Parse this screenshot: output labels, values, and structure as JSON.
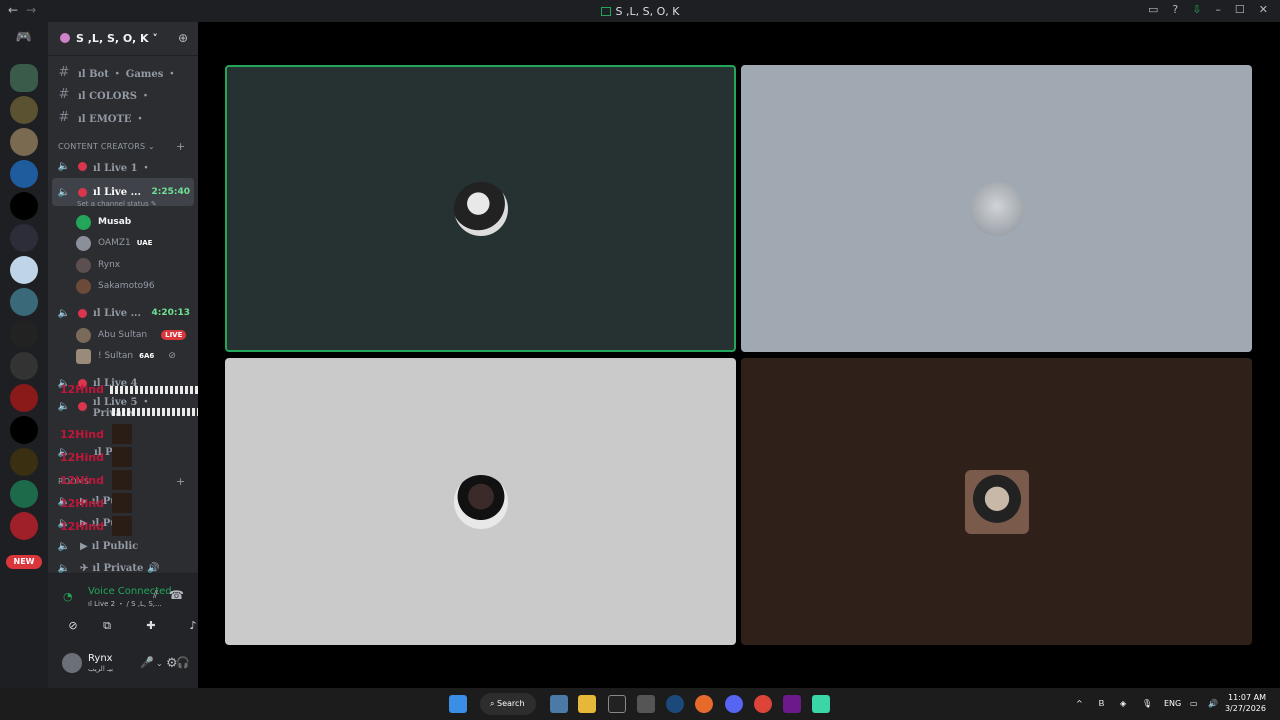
{
  "window": {
    "title": "S ,L, S, O, K"
  },
  "server": {
    "name": "S ,L, S, O, K"
  },
  "channels": {
    "text": [
      {
        "label": "ıl Bot ・ Games ・"
      },
      {
        "label": "ıl COLORS ・"
      },
      {
        "label": "ıl EMOTE ・"
      }
    ],
    "category": "CONTENT CREATORS",
    "voice1": {
      "label": "ıl Live 1 ・"
    },
    "voice2": {
      "label": "ıl Live ...",
      "time": "2:25:40",
      "status": "Set a channel status"
    },
    "voice2_users": [
      {
        "name": "Musab"
      },
      {
        "name": "OAMZ1",
        "tag": "UAE"
      },
      {
        "name": "Rynx"
      },
      {
        "name": "Sakamoto96"
      }
    ],
    "voice3": {
      "label": "ıl Live ...",
      "time": "4:20:13"
    },
    "voice3_users": [
      {
        "name": "Abu Sultan",
        "badge": "LIVE"
      },
      {
        "name": "! Sultan",
        "tag": "6A6"
      }
    ],
    "voice4": {
      "label": "ıl Live 4"
    },
    "voice5": {
      "label": "ıl Live 5 ・ Private"
    },
    "pull": {
      "label": "ıl Pull"
    },
    "category2": "ROOMS",
    "pu1": {
      "label": "ıl Pu"
    },
    "pu2": {
      "label": "ıl Pu"
    },
    "public": {
      "label": "ıl Public"
    },
    "private": {
      "label": "ıl Private"
    }
  },
  "overlay": {
    "text": "12Hind"
  },
  "voice_panel": {
    "title": "Voice Connected",
    "subtitle": "ıl Live 2 ・ / S ,L, S,..."
  },
  "user_panel": {
    "name": "Rynx",
    "status": "بيـ الريب"
  },
  "rail": {
    "new_label": "NEW"
  },
  "taskbar": {
    "search": "Search",
    "lang": "ENG",
    "time": "11:07 AM",
    "date": "3/27/2026"
  },
  "colors": {
    "accent_green": "#23a55a",
    "live_red": "#da373c",
    "tile1": "#263131",
    "tile2": "#a0a8b2",
    "tile3": "#cacaca",
    "tile4": "#2f201a"
  }
}
